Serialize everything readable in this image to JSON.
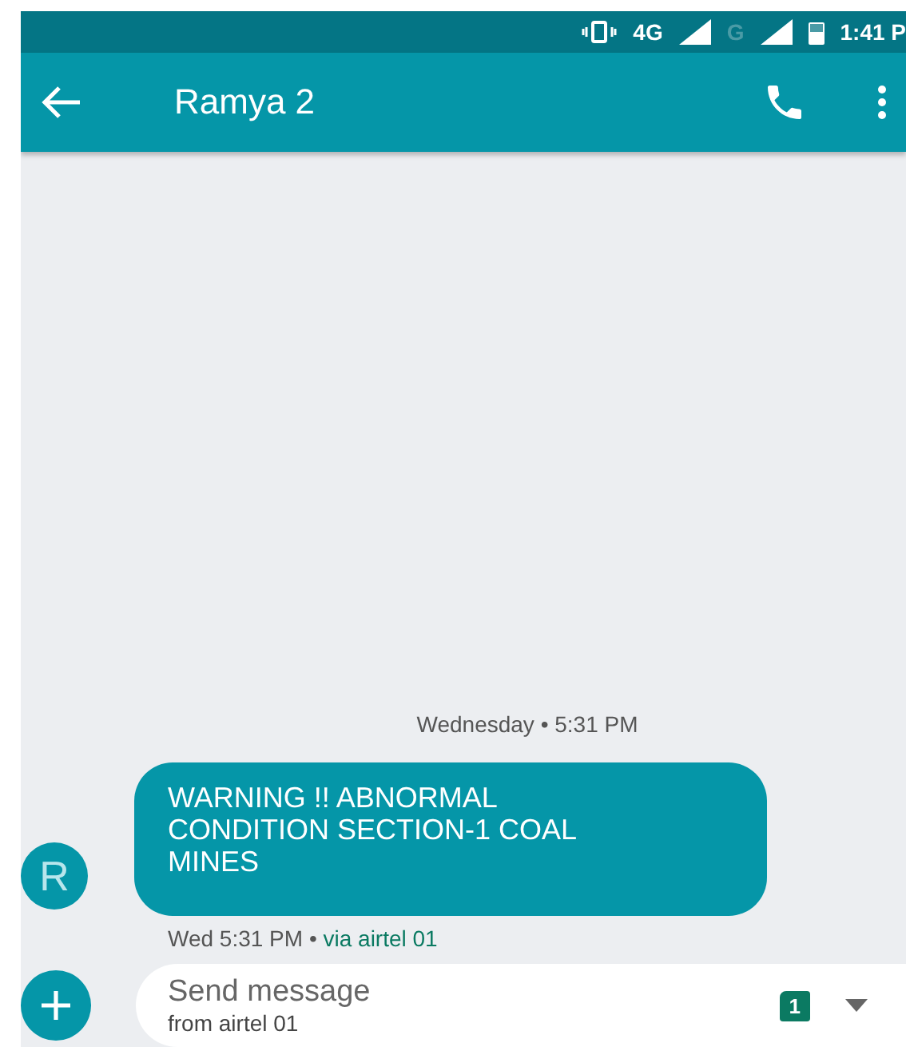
{
  "status_bar": {
    "network": "4G",
    "network_2": "G",
    "time": "1:41 P"
  },
  "app_bar": {
    "title": "Ramya 2"
  },
  "date_divider": "Wednesday • 5:31 PM",
  "messages": [
    {
      "avatar": "R",
      "text": "WARNING !! ABNORMAL CONDITION SECTION-1 COAL MINES",
      "time": "Wed 5:31 PM • ",
      "via": "via airtel 01"
    }
  ],
  "composer": {
    "placeholder": "Send message",
    "sub": "from airtel 01",
    "sim": "1"
  }
}
